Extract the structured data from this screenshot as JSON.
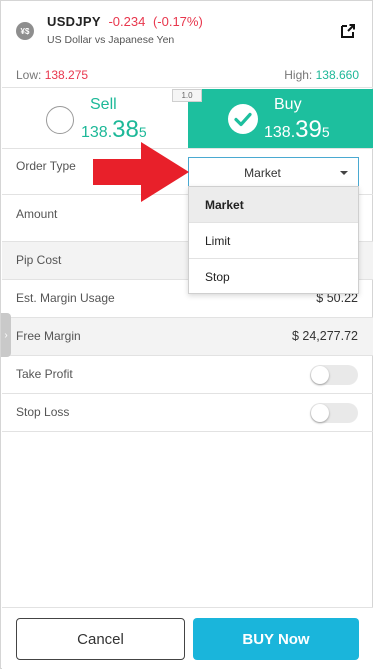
{
  "instrument": {
    "icon_label": "¥$",
    "symbol": "USDJPY",
    "change": "-0.234",
    "change_pct": "(-0.17%)",
    "description": "US Dollar vs Japanese Yen",
    "low_label": "Low:",
    "low_value": "138.275",
    "high_label": "High:",
    "high_value": "138.660"
  },
  "trade": {
    "sell_label": "Sell",
    "sell_price_main": "138.",
    "sell_price_big": "38",
    "sell_price_pip": "5",
    "buy_label": "Buy",
    "buy_price_main": "138.",
    "buy_price_big": "39",
    "buy_price_pip": "5",
    "spread": "1.0",
    "selected_side": "buy"
  },
  "form": {
    "order_type_label": "Order Type",
    "order_type_value": "Market",
    "order_type_options": [
      "Market",
      "Limit",
      "Stop"
    ],
    "amount_label": "Amount",
    "pip_cost_label": "Pip Cost",
    "est_margin_label": "Est. Margin Usage",
    "est_margin_value": "$ 50.22",
    "free_margin_label": "Free Margin",
    "free_margin_value": "$ 24,277.72",
    "take_profit_label": "Take Profit",
    "take_profit_on": false,
    "stop_loss_label": "Stop Loss",
    "stop_loss_on": false
  },
  "footer": {
    "cancel_label": "Cancel",
    "submit_label": "BUY Now"
  },
  "colors": {
    "up": "#1db898",
    "down": "#e8374d",
    "buy_bg": "#1dbf9e",
    "submit_bg": "#1ab5db",
    "annotation_arrow": "#e8202a"
  }
}
